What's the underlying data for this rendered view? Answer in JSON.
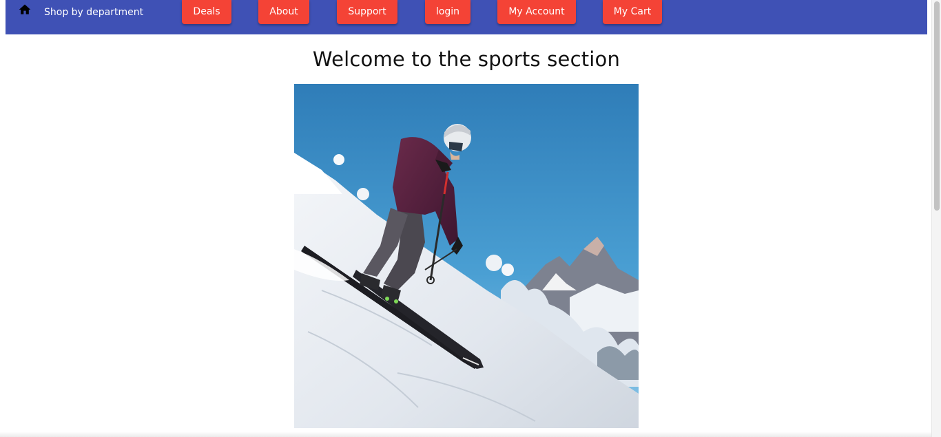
{
  "navbar": {
    "background_color": "#3f51b5",
    "home_icon": "home-icon",
    "shop_by_department": "Shop by department",
    "button_color": "#f44336",
    "buttons": {
      "deals": "Deals",
      "about": "About",
      "support": "Support",
      "login": "login",
      "my_account": "My Account",
      "my_cart": "My Cart"
    }
  },
  "main": {
    "heading": "Welcome to the sports section",
    "hero_image": "skier-on-snowy-slope"
  }
}
